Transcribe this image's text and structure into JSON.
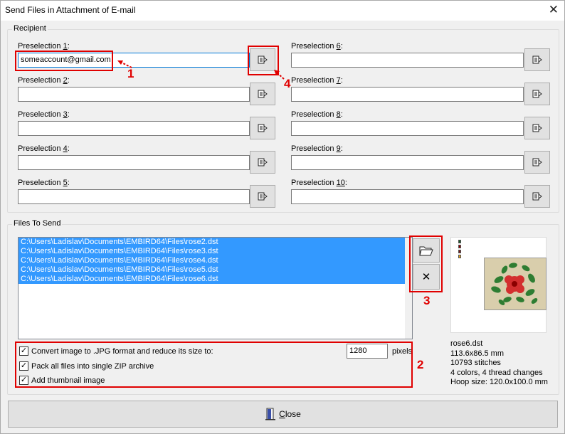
{
  "window": {
    "title": "Send Files in Attachment of E-mail",
    "close_glyph": "✕"
  },
  "recipient": {
    "legend": "Recipient",
    "preselections": [
      {
        "prefix": "Preselection ",
        "num": "1",
        "suffix": ":",
        "value": "someaccount@gmail.com"
      },
      {
        "prefix": "Preselection ",
        "num": "2",
        "suffix": ":",
        "value": ""
      },
      {
        "prefix": "Preselection ",
        "num": "3",
        "suffix": ":",
        "value": ""
      },
      {
        "prefix": "Preselection ",
        "num": "4",
        "suffix": ":",
        "value": ""
      },
      {
        "prefix": "Preselection ",
        "num": "5",
        "suffix": ":",
        "value": ""
      },
      {
        "prefix": "Preselection ",
        "num": "6",
        "suffix": ":",
        "value": ""
      },
      {
        "prefix": "Preselection ",
        "num": "7",
        "suffix": ":",
        "value": ""
      },
      {
        "prefix": "Preselection ",
        "num": "8",
        "suffix": ":",
        "value": ""
      },
      {
        "prefix": "Preselection ",
        "num": "9",
        "suffix": ":",
        "value": ""
      },
      {
        "prefix": "Preselection ",
        "num": "10",
        "suffix": ":",
        "value": ""
      }
    ],
    "address_book_icon": "address-book-icon"
  },
  "files": {
    "legend": "Files To Send",
    "items": [
      "C:\\Users\\Ladislav\\Documents\\EMBIRD64\\Files\\rose2.dst",
      "C:\\Users\\Ladislav\\Documents\\EMBIRD64\\Files\\rose3.dst",
      "C:\\Users\\Ladislav\\Documents\\EMBIRD64\\Files\\rose4.dst",
      "C:\\Users\\Ladislav\\Documents\\EMBIRD64\\Files\\rose5.dst",
      "C:\\Users\\Ladislav\\Documents\\EMBIRD64\\Files\\rose6.dst"
    ],
    "add_icon": "open-folder-icon",
    "remove_icon": "delete-x-icon",
    "remove_glyph": "✕"
  },
  "options": {
    "convert_label": "Convert image to .JPG format and reduce its size to:",
    "convert_checked": true,
    "pixels_value": "1280",
    "pixels_label": "pixels",
    "zip_label": "Pack all files into single ZIP archive",
    "zip_checked": true,
    "thumb_label": "Add thumbnail image",
    "thumb_checked": true,
    "check_glyph": "✓"
  },
  "preview": {
    "filename": "rose6.dst",
    "size": "113.6x86.5 mm",
    "stitches": "10793 stitches",
    "colors": "4 colors, 4 thread changes",
    "hoop": "Hoop size: 120.0x100.0 mm",
    "thread_colors": [
      "#1a5c2a",
      "#8b0000",
      "#7a1a1a",
      "#e0a020"
    ],
    "fabric_color": "#d9ceac"
  },
  "annotations": {
    "n1": "1",
    "n2": "2",
    "n3": "3",
    "n4": "4",
    "color": "#e00000"
  },
  "footer": {
    "close_label": "Close",
    "close_icon": "door-exit-icon"
  }
}
